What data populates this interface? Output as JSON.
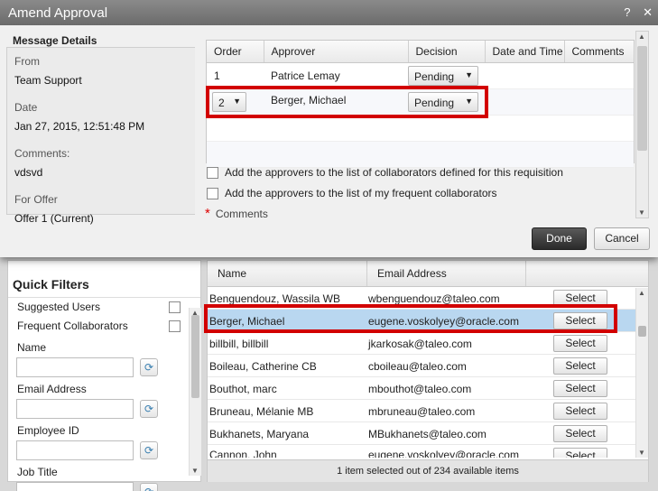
{
  "dialog": {
    "title": "Amend Approval",
    "message_details": {
      "heading": "Message Details",
      "from_label": "From",
      "from_value": "Team Support",
      "date_label": "Date",
      "date_value": "Jan 27, 2015, 12:51:48 PM",
      "comments_label": "Comments:",
      "comments_value": "vdsvd",
      "offer_label": "For Offer",
      "offer_value": "Offer 1 (Current)"
    },
    "approvers_table": {
      "columns": [
        "Order",
        "Approver",
        "Decision",
        "Date and Time",
        "Comments"
      ],
      "rows": [
        {
          "order": "1",
          "approver": "Patrice Lemay",
          "decision": "Pending"
        },
        {
          "order": "2",
          "approver": "Berger, Michael",
          "decision": "Pending"
        }
      ]
    },
    "checkbox_collaborators": "Add the approvers to the list of collaborators defined for this requisition",
    "checkbox_frequent": "Add the approvers to the list of my frequent collaborators",
    "required_mark": "*",
    "comments_label": "Comments",
    "done_label": "Done",
    "cancel_label": "Cancel"
  },
  "filters": {
    "heading": "Quick Filters",
    "suggested_users": "Suggested Users",
    "frequent_collaborators": "Frequent Collaborators",
    "name_label": "Name",
    "email_label": "Email Address",
    "employee_id_label": "Employee ID",
    "job_title_label": "Job Title"
  },
  "users": {
    "columns": [
      "Name",
      "Email Address"
    ],
    "select_label": "Select",
    "rows": [
      {
        "name": "Benguendouz, Wassila WB",
        "email": "wbenguendouz@taleo.com"
      },
      {
        "name": "Berger, Michael",
        "email": "eugene.voskolyey@oracle.com"
      },
      {
        "name": "billbill, billbill",
        "email": "jkarkosak@taleo.com"
      },
      {
        "name": "Boileau, Catherine CB",
        "email": "cboileau@taleo.com"
      },
      {
        "name": "Bouthot, marc",
        "email": "mbouthot@taleo.com"
      },
      {
        "name": "Bruneau, Mélanie MB",
        "email": "mbruneau@taleo.com"
      },
      {
        "name": "Bukhanets, Maryana",
        "email": "MBukhanets@taleo.com"
      },
      {
        "name": "Cannon, John",
        "email": "eugene.voskolyey@oracle.com"
      }
    ],
    "status": "1 item selected out of 234 available items"
  },
  "icons": {
    "refresh": "refresh-icon",
    "help": "help-icon",
    "close": "close-icon",
    "dropdown": "chevron-down-icon"
  },
  "colors": {
    "highlight": "#d20000",
    "selected_row": "#b9d7f0",
    "titlebar": "#7a7a7a"
  }
}
